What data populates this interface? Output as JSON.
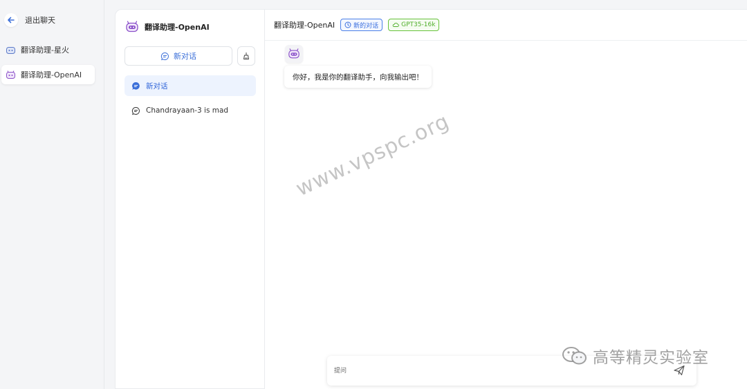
{
  "sidebar": {
    "back_label": "退出聊天",
    "bots": [
      {
        "label": "翻译助理-星火",
        "active": false
      },
      {
        "label": "翻译助理-OpenAI",
        "active": true
      }
    ]
  },
  "conversations": {
    "header_title": "翻译助理-OpenAI",
    "new_chat_label": "新对话",
    "items": [
      {
        "label": "新对话",
        "active": true
      },
      {
        "label": "Chandrayaan-3 is mad",
        "active": false
      }
    ]
  },
  "chat": {
    "title": "翻译助理-OpenAI",
    "tag_new": "新的对话",
    "tag_model": "GPT35-16k",
    "greeting": "你好，我是你的翻译助手，向我输出吧！",
    "input_placeholder": "提问"
  },
  "overlay": {
    "watermark": "www.vpspc.org",
    "brand": "高等精灵实验室"
  },
  "colors": {
    "accent": "#2f64d8",
    "tag_blue": "#3a6fde",
    "tag_green": "#4fae2a",
    "bot_purple": "#8a4fc9"
  }
}
